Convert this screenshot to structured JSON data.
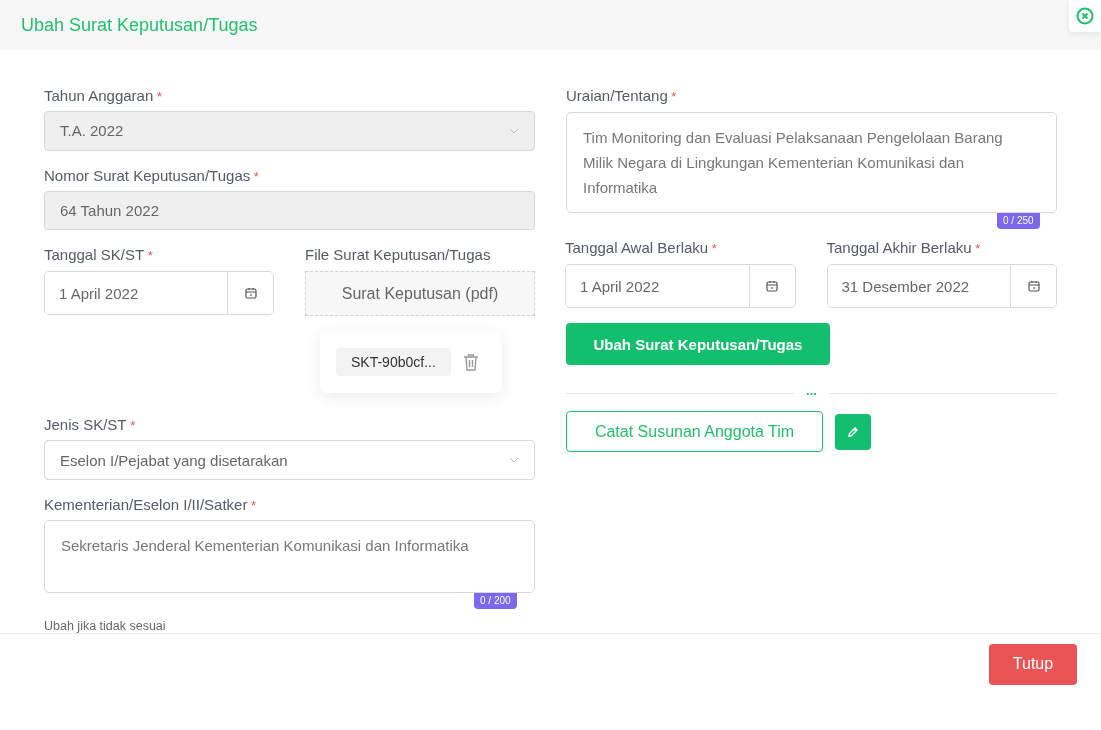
{
  "dialog": {
    "title": "Ubah Surat Keputusan/Tugas"
  },
  "left": {
    "budget_year": {
      "label": "Tahun Anggaran",
      "required_mark": "*",
      "value": "T.A. 2022",
      "disabled": true
    },
    "decree_number": {
      "label": "Nomor Surat Keputusan/Tugas",
      "required_mark": "*",
      "value": "64 Tahun 2022",
      "disabled": true
    },
    "decree_date": {
      "label": "Tanggal SK/ST",
      "required_mark": "*",
      "value": "1 April 2022"
    },
    "decree_file": {
      "label": "File Surat Keputusan/Tugas",
      "drop_label": "Surat Keputusan (pdf)",
      "file_name": "SKT-90b0cf..."
    },
    "decree_type": {
      "label": "Jenis SK/ST",
      "required_mark": "*",
      "value": "Eselon I/Pejabat yang disetarakan",
      "disabled": false
    },
    "unit": {
      "label": "Kementerian/Eselon I/II/Satker",
      "required_mark": "*",
      "value": "Sekretaris Jenderal Kementerian Komunikasi dan Informatika",
      "counter": "0 / 200",
      "hint": "Ubah jika tidak sesuai"
    }
  },
  "right": {
    "description": {
      "label": "Uraian/Tentang",
      "required_mark": "*",
      "value": "Tim Monitoring dan Evaluasi Pelaksanaan Pengelolaan Barang Milik Negara di Lingkungan Kementerian Komunikasi dan Informatika",
      "counter": "0 / 250"
    },
    "start_date": {
      "label": "Tanggal Awal Berlaku",
      "required_mark": "*",
      "value": "1 April 2022"
    },
    "end_date": {
      "label": "Tanggal Akhir Berlaku",
      "required_mark": "*",
      "value": "31 Desember 2022"
    },
    "submit_button": "Ubah Surat Keputusan/Tugas",
    "divider_mark": "...",
    "team_button": "Catat Susunan Anggota Tim"
  },
  "footer": {
    "close_button": "Tutup"
  }
}
